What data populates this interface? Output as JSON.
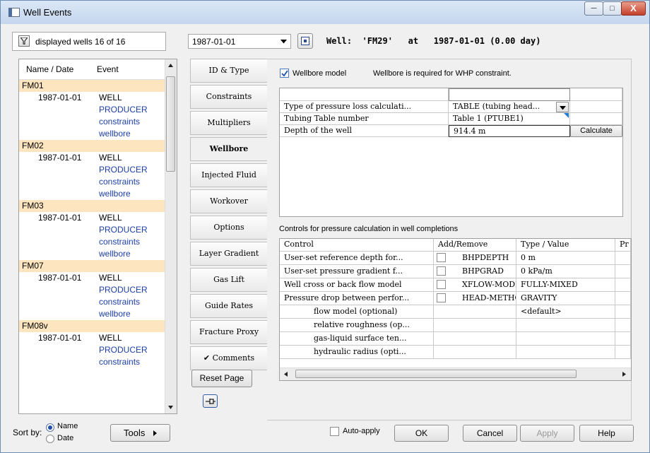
{
  "window": {
    "title": "Well Events",
    "minimize": "─",
    "maximize": "□",
    "close": "X"
  },
  "toolbar": {
    "filter_label": "displayed wells 16 of 16",
    "date_value": "1987-01-01",
    "well_info": "Well:  'FM29'   at   1987-01-01 (0.00 day)"
  },
  "tree": {
    "col_name": "Name / Date",
    "col_event": "Event",
    "rows": [
      {
        "type": "group",
        "name": "FM01",
        "date": "",
        "event": ""
      },
      {
        "type": "item",
        "name": "",
        "date": "1987-01-01",
        "event": "WELL"
      },
      {
        "type": "item",
        "name": "",
        "date": "",
        "event": "PRODUCER"
      },
      {
        "type": "item",
        "name": "",
        "date": "",
        "event": "constraints"
      },
      {
        "type": "item",
        "name": "",
        "date": "",
        "event": "wellbore"
      },
      {
        "type": "group",
        "name": "FM02",
        "date": "",
        "event": ""
      },
      {
        "type": "item",
        "name": "",
        "date": "1987-01-01",
        "event": "WELL"
      },
      {
        "type": "item",
        "name": "",
        "date": "",
        "event": "PRODUCER"
      },
      {
        "type": "item",
        "name": "",
        "date": "",
        "event": "constraints"
      },
      {
        "type": "item",
        "name": "",
        "date": "",
        "event": "wellbore"
      },
      {
        "type": "group",
        "name": "FM03",
        "date": "",
        "event": ""
      },
      {
        "type": "item",
        "name": "",
        "date": "1987-01-01",
        "event": "WELL"
      },
      {
        "type": "item",
        "name": "",
        "date": "",
        "event": "PRODUCER"
      },
      {
        "type": "item",
        "name": "",
        "date": "",
        "event": "constraints"
      },
      {
        "type": "item",
        "name": "",
        "date": "",
        "event": "wellbore"
      },
      {
        "type": "group",
        "name": "FM07",
        "date": "",
        "event": ""
      },
      {
        "type": "item",
        "name": "",
        "date": "1987-01-01",
        "event": "WELL"
      },
      {
        "type": "item",
        "name": "",
        "date": "",
        "event": "PRODUCER"
      },
      {
        "type": "item",
        "name": "",
        "date": "",
        "event": "constraints"
      },
      {
        "type": "item",
        "name": "",
        "date": "",
        "event": "wellbore"
      },
      {
        "type": "group",
        "name": "FM08v",
        "date": "",
        "event": ""
      },
      {
        "type": "item",
        "name": "",
        "date": "1987-01-01",
        "event": "WELL"
      },
      {
        "type": "item",
        "name": "",
        "date": "",
        "event": "PRODUCER"
      },
      {
        "type": "item",
        "name": "",
        "date": "",
        "event": "constraints"
      }
    ]
  },
  "tabs": [
    {
      "label": "ID & Type",
      "active": false
    },
    {
      "label": "Constraints",
      "active": false
    },
    {
      "label": "Multipliers",
      "active": false
    },
    {
      "label": "Wellbore",
      "active": true
    },
    {
      "label": "Injected Fluid",
      "active": false
    },
    {
      "label": "Workover",
      "active": false
    },
    {
      "label": "Options",
      "active": false
    },
    {
      "label": "Layer Gradient",
      "active": false
    },
    {
      "label": "Gas Lift",
      "active": false
    },
    {
      "label": "Guide Rates",
      "active": false
    },
    {
      "label": "Fracture Proxy",
      "active": false
    },
    {
      "label": "✔ Comments",
      "active": false
    }
  ],
  "reset_page": "Reset Page",
  "wellbore": {
    "checkbox_label": "Wellbore model",
    "note": "Wellbore is required for WHP constraint.",
    "rows": [
      {
        "label": "Type of pressure loss calculati...",
        "value": "TABLE (tubing head...",
        "extra": ""
      },
      {
        "label": "Tubing Table number",
        "value": "Table 1 (PTUBE1)",
        "extra": ""
      },
      {
        "label": "Depth of the well",
        "value": "914.4  m",
        "extra": "Calculate"
      }
    ]
  },
  "controls": {
    "title": "Controls for pressure calculation in well completions",
    "headers": [
      "Control",
      "Add/Remove",
      "Type / Value",
      "Pr"
    ],
    "rows": [
      {
        "control": "User-set reference depth for...",
        "check": true,
        "keyword": "BHPDEPTH",
        "value": "0  m"
      },
      {
        "control": "User-set pressure gradient f...",
        "check": true,
        "keyword": "BHPGRAD",
        "value": "0  kPa/m"
      },
      {
        "control": "Well cross or back flow model",
        "check": true,
        "keyword": "XFLOW-MODEL",
        "value": "FULLY-MIXED"
      },
      {
        "control": "Pressure drop between perfor...",
        "check": true,
        "keyword": "HEAD-METHOD",
        "value": "GRAVITY"
      },
      {
        "control": "flow model (optional)",
        "check": false,
        "keyword": "",
        "value": "<default>"
      },
      {
        "control": "relative roughness (op...",
        "check": false,
        "keyword": "",
        "value": ""
      },
      {
        "control": "gas-liquid surface ten...",
        "check": false,
        "keyword": "",
        "value": ""
      },
      {
        "control": "hydraulic radius (opti...",
        "check": false,
        "keyword": "",
        "value": ""
      }
    ]
  },
  "footer": {
    "sort_label": "Sort by:",
    "sort_name": "Name",
    "sort_date": "Date",
    "tools": "Tools",
    "auto_apply": "Auto-apply",
    "ok": "OK",
    "cancel": "Cancel",
    "apply": "Apply",
    "help": "Help"
  }
}
